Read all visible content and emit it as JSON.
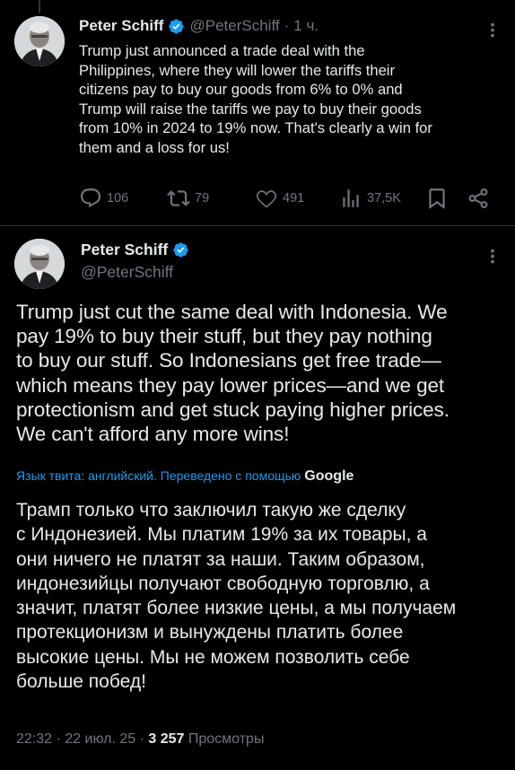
{
  "tweet1": {
    "author_name": "Peter Schiff",
    "author_handle": "@PeterSchiff",
    "time_sep": "·",
    "time": "1 ч.",
    "text": "Trump just announced a trade deal with the\nPhilippines, where they will lower the tariffs their\ncitizens pay to buy our goods from 6% to 0% and\nTrump will raise the tariffs we pay to buy their goods\nfrom 10% in 2024 to 19% now. That's clearly a win for\nthem and a loss for us!",
    "replies": "106",
    "reposts": "79",
    "likes": "491",
    "views": "37,5K"
  },
  "tweet2": {
    "author_name": "Peter Schiff",
    "author_handle": "@PeterSchiff",
    "text": "Trump just cut the same deal with Indonesia. We\npay 19% to buy their stuff, but they pay nothing\nto buy our stuff. So Indonesians get free trade—\nwhich means they pay lower prices—and we get\nprotectionism and get stuck paying higher prices.\nWe can't afford any more wins!",
    "translate_note": "Язык твита: английский. Переведено с помощью",
    "translate_provider": "Google",
    "translation": "Трамп только что заключил такую же сделку\nс Индонезией. Мы платим 19% за их товары, а\nони ничего не платят за наши. Таким образом,\nиндонезийцы получают свободную торговлю, а\nзначит, платят более низкие цены, а мы получаем\nпротекционизм и вынуждены платить более\nвысокие цены. Мы не можем позволить себе\nбольше побед!",
    "time": "22:32",
    "date": "22 июл. 25",
    "dot": "·",
    "views_count": "3 257",
    "views_label": "Просмотры"
  },
  "colors": {
    "background": "#000000",
    "text": "#e7e9ea",
    "secondary": "#71767b",
    "accent": "#1d9bf0",
    "divider": "#2f3336"
  },
  "icons": [
    "verified-badge-icon",
    "more-icon",
    "reply-icon",
    "repost-icon",
    "like-icon",
    "views-icon",
    "bookmark-icon",
    "share-icon"
  ]
}
